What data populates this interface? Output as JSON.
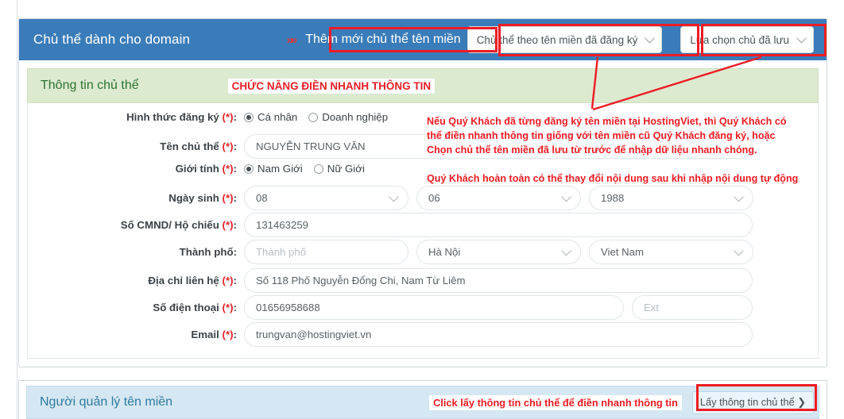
{
  "header": {
    "title": "Chủ thể dành cho domain",
    "marker": "≫",
    "add_new_link": "Thêm mới chủ thể tên miền",
    "select_registered": "Chủ thể theo tên miền đã đăng ký",
    "select_saved": "Lựa chọn chủ đã lưu"
  },
  "subject_section": {
    "title": "Thông tin chủ thể",
    "quickfill_note": "CHỨC NĂNG ĐIỀN NHANH THÔNG TIN"
  },
  "annotations": {
    "tooltip_line1": "Nếu Quý Khách đã từng đăng ký tên miền tại HostingViet, thì Quý Khách có",
    "tooltip_line2": "thể điền nhanh thông tin giống với tên miền cũ Quý Khách đăng ký, hoặc",
    "tooltip_line3": "Chọn chủ thể tên miền đã lưu từ trước để nhập dữ liệu nhanh chóng.",
    "tooltip_line4": "Quý Khách hoàn toàn có thể thay đổi nội dung sau khi nhập nội dung tự động",
    "click_note": "Click lấy thông tin chủ thể để điền nhanh thông tin"
  },
  "form": {
    "registration_type": {
      "label": "Hình thức đăng ký",
      "required": "(*)",
      "options": [
        {
          "label": "Cá nhân",
          "selected": true
        },
        {
          "label": "Doanh nghiệp",
          "selected": false
        }
      ]
    },
    "subject_name": {
      "label": "Tên chủ thể",
      "required": "(*)",
      "value": "NGUYỄN TRUNG VĂN"
    },
    "gender": {
      "label": "Giới tính",
      "required": "(*)",
      "options": [
        {
          "label": "Nam Giới",
          "selected": true
        },
        {
          "label": "Nữ Giới",
          "selected": false
        }
      ]
    },
    "birthday": {
      "label": "Ngày sinh",
      "required": "(*)",
      "day": "08",
      "month": "06",
      "year": "1988"
    },
    "id_number": {
      "label": "Số CMND/ Hộ chiếu",
      "required": "(*)",
      "value": "131463259"
    },
    "city": {
      "label": "Thành phố:",
      "placeholder": "Thành phố",
      "province": "Hà Nội",
      "country": "Viet Nam"
    },
    "address": {
      "label": "Địa chỉ liên hệ",
      "required": "(*)",
      "value": "Số 118 Phố Nguyễn Đổng Chi, Nam Từ Liêm"
    },
    "phone": {
      "label": "Số điện thoại",
      "required": "(*)",
      "value": "01656958688",
      "ext_placeholder": "Ext"
    },
    "email": {
      "label": "Email",
      "required": "(*)",
      "value": "trungvan@hostingviet.vn"
    }
  },
  "manager_section": {
    "title": "Người quản lý tên miền",
    "get_info_button": "Lấy thông tin chủ thể ❯"
  },
  "colors": {
    "header_blue": "#3a7cb9",
    "green_bg": "#dcead0",
    "green_text": "#2e7332",
    "blue_bg": "#d5e7f2",
    "blue_text": "#2f7ba0",
    "annotation_red": "#ee1c24",
    "marker_red": "#e03a3a"
  }
}
